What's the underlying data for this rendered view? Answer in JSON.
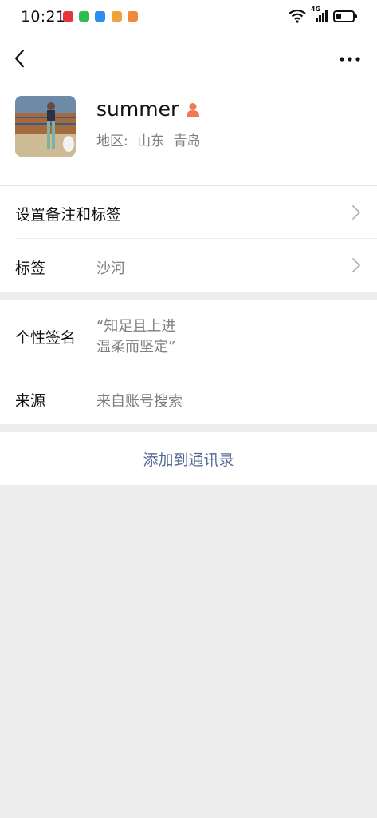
{
  "status_bar": {
    "time": "10:21",
    "network": "4G"
  },
  "colors": {
    "link": "#576b95",
    "secondary_text": "#808080",
    "background": "#ededed"
  },
  "profile": {
    "name": "summer",
    "region_label": "地区:",
    "region_province": "山东",
    "region_city": "青岛"
  },
  "rows": {
    "remark": {
      "label": "设置备注和标签"
    },
    "tags": {
      "label": "标签",
      "value": "沙河"
    },
    "signature": {
      "label": "个性签名",
      "line1": "“知足且上进",
      "line2": "温柔而坚定”"
    },
    "source": {
      "label": "来源",
      "value": "来自账号搜索"
    }
  },
  "actions": {
    "add_contact": "添加到通讯录"
  }
}
